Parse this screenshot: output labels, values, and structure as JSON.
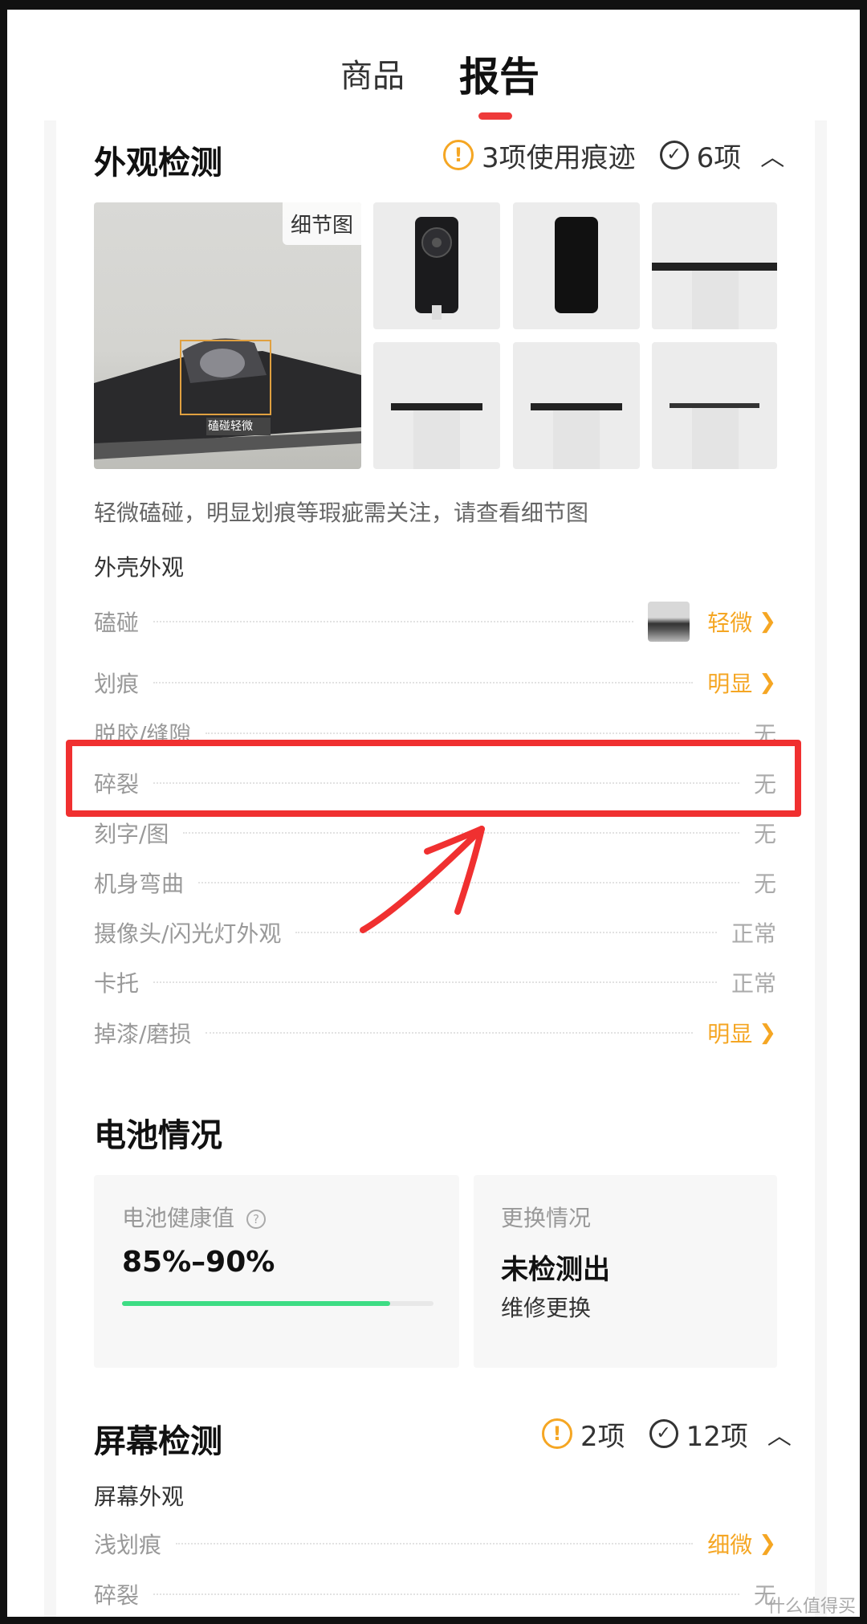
{
  "tabs": {
    "goods": "商品",
    "report": "报告"
  },
  "appearance": {
    "title": "外观检测",
    "warn_count": "3项使用痕迹",
    "ok_count": "6项",
    "detail_badge": "细节图",
    "photo_tag": "磕碰轻微",
    "note": "轻微磕碰，明显划痕等瑕疵需关注，请查看细节图",
    "group_title": "外壳外观",
    "rows": [
      {
        "label": "磕碰",
        "value": "轻微"
      },
      {
        "label": "划痕",
        "value": "明显"
      },
      {
        "label": "脱胶/缝隙",
        "value": "无"
      },
      {
        "label": "碎裂",
        "value": "无"
      },
      {
        "label": "刻字/图",
        "value": "无"
      },
      {
        "label": "机身弯曲",
        "value": "无"
      },
      {
        "label": "摄像头/闪光灯外观",
        "value": "正常"
      },
      {
        "label": "卡托",
        "value": "正常"
      },
      {
        "label": "掉漆/磨损",
        "value": "明显"
      }
    ]
  },
  "battery": {
    "title": "电池情况",
    "health_label": "电池健康值",
    "health_value": "85%–90%",
    "health_fill": 0.86,
    "replace_label": "更换情况",
    "replace_value": "未检测出",
    "replace_sub": "维修更换"
  },
  "screen": {
    "title": "屏幕检测",
    "warn_count": "2项",
    "ok_count": "12项",
    "group_title": "屏幕外观",
    "rows": [
      {
        "label": "浅划痕",
        "value": "细微"
      },
      {
        "label": "碎裂",
        "value": "无"
      }
    ]
  },
  "watermark": "什么值得买",
  "colors": {
    "accent_red": "#ee3a3a",
    "warn": "#f5a623",
    "battery_bar": "#3ddc84",
    "annotation": "#f03030"
  }
}
